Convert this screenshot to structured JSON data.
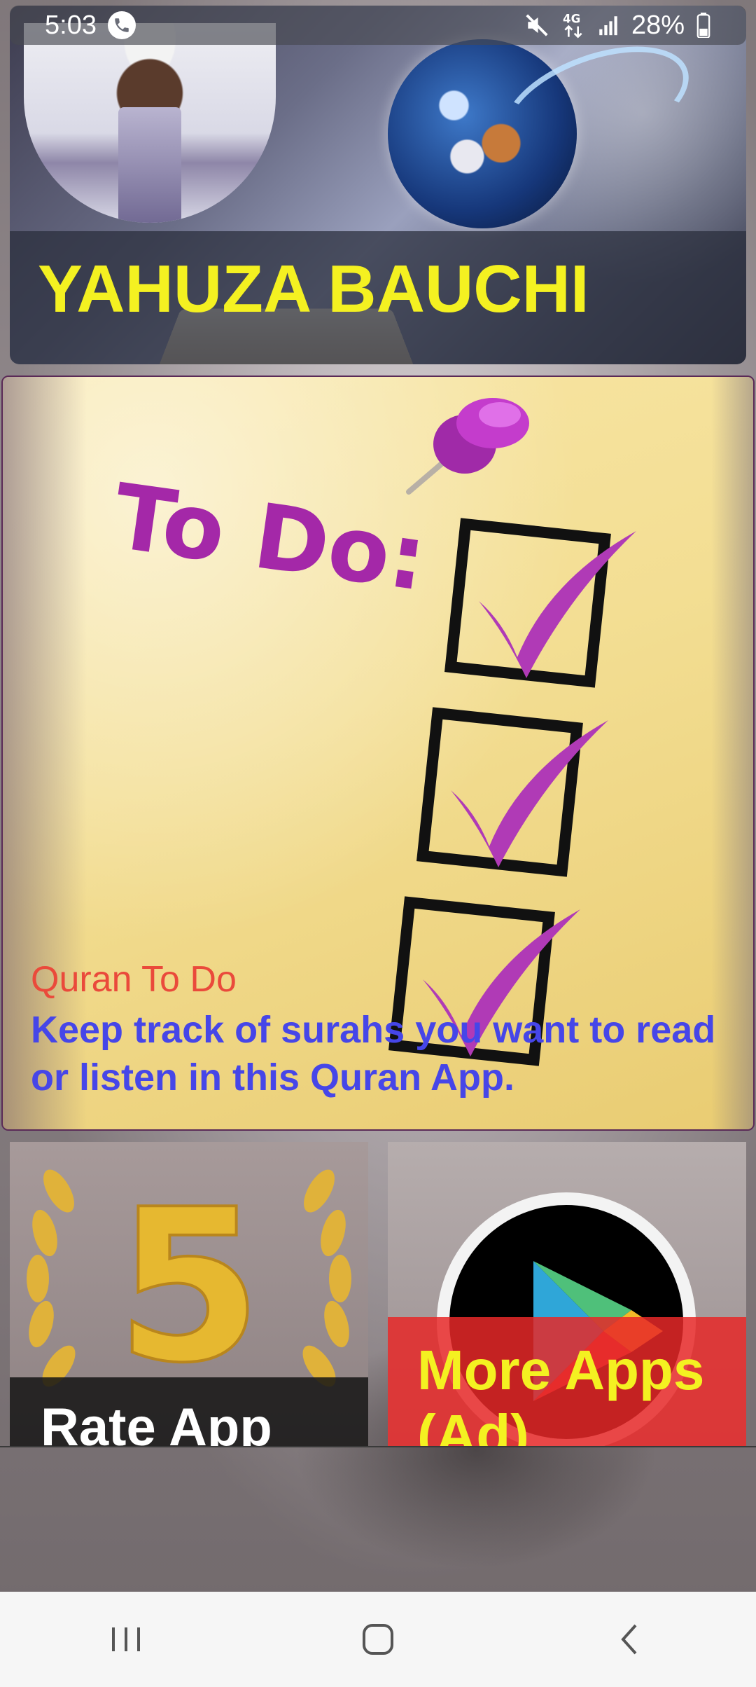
{
  "status_bar": {
    "time": "5:03",
    "battery_percent": "28%",
    "network": "4G",
    "icons": [
      "call-icon",
      "mute-icon",
      "network-4g-icon",
      "signal-icon",
      "battery-icon"
    ]
  },
  "header": {
    "title": "YAHUZA BAUCHI",
    "title_color": "#f4f121"
  },
  "todo_card": {
    "image_text": "To Do:",
    "label": "Quran To Do",
    "description": "Keep track of surahs you want to read or listen in this Quran App.",
    "label_color": "#ea4a3b",
    "description_color": "#4646e8"
  },
  "tiles": {
    "rate": {
      "label": "Rate App",
      "image_text": "5"
    },
    "more": {
      "label": "More Apps (Ad)"
    }
  },
  "nav_bar": {
    "buttons": [
      "recents-icon",
      "home-icon",
      "back-icon"
    ]
  }
}
